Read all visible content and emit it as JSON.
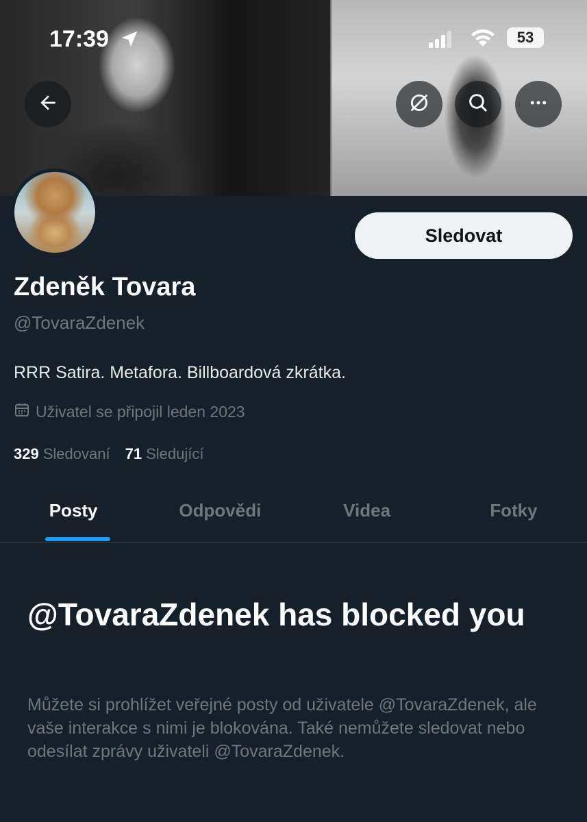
{
  "status_bar": {
    "time": "17:39",
    "battery": "53"
  },
  "header": {
    "banner_description_icons": [
      "back-arrow-icon",
      "grok-icon",
      "search-icon",
      "more-icon"
    ]
  },
  "profile": {
    "follow_label": "Sledovat",
    "display_name": "Zdeněk Tovara",
    "handle": "@TovaraZdenek",
    "bio": "RRR Satira. Metafora. Billboardová zkrátka.",
    "joined": "Uživatel se připojil leden 2023",
    "following_count": "329",
    "following_label": "Sledovaní",
    "followers_count": "71",
    "followers_label": "Sledující"
  },
  "tabs": [
    {
      "label": "Posty",
      "active": true
    },
    {
      "label": "Odpovědi",
      "active": false
    },
    {
      "label": "Videa",
      "active": false
    },
    {
      "label": "Fotky",
      "active": false
    }
  ],
  "blocked": {
    "title": "@TovaraZdenek has blocked you",
    "description": "Můžete si prohlížet veřejné posty od uživatele @TovaraZdenek, ale vaše interakce s nimi je blokována. Také nemůžete sledovat nebo odesílat zprávy uživateli @TovaraZdenek."
  },
  "colors": {
    "background": "#15202b",
    "accent": "#1d9bf0",
    "muted_text": "#71767b"
  }
}
